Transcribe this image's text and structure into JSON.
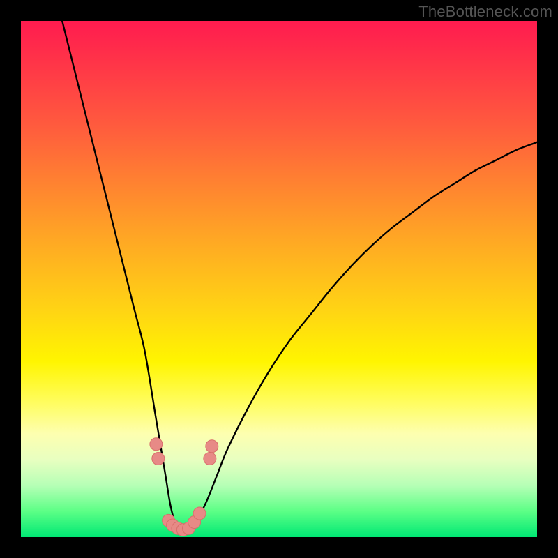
{
  "attribution": "TheBottleneck.com",
  "colors": {
    "frame_background": "#000000",
    "gradient_top": "#ff1b4f",
    "gradient_bottom": "#00e874",
    "curve_stroke": "#000000",
    "marker_fill": "#e78a86",
    "marker_stroke": "#d86f6b",
    "attribution_text": "#555555"
  },
  "chart_data": {
    "type": "line",
    "title": "",
    "xlabel": "",
    "ylabel": "",
    "xlim": [
      0,
      100
    ],
    "ylim": [
      0,
      100
    ],
    "grid": false,
    "note": "Axes are implicit (no visible tick labels in source image). x spans 0–100% of plot width, y spans 0–100% of plot height (0 at bottom). Values read from pixel positions.",
    "series": [
      {
        "name": "bottleneck-curve",
        "x": [
          8,
          10,
          12,
          14,
          16,
          18,
          20,
          22,
          24,
          26,
          27,
          28,
          29,
          30,
          31,
          32,
          33,
          34,
          36,
          38,
          40,
          44,
          48,
          52,
          56,
          60,
          64,
          68,
          72,
          76,
          80,
          84,
          88,
          92,
          96,
          100
        ],
        "y": [
          100,
          92,
          84,
          76,
          68,
          60,
          52,
          44,
          36,
          24,
          18,
          12,
          6,
          2.5,
          1.5,
          1.2,
          1.5,
          3,
          7,
          12,
          17,
          25,
          32,
          38,
          43,
          48,
          52.5,
          56.5,
          60,
          63,
          66,
          68.5,
          71,
          73,
          75,
          76.5
        ]
      }
    ],
    "markers": [
      {
        "x": 26.2,
        "y": 18.0
      },
      {
        "x": 26.6,
        "y": 15.2
      },
      {
        "x": 28.6,
        "y": 3.2
      },
      {
        "x": 29.4,
        "y": 2.3
      },
      {
        "x": 30.4,
        "y": 1.7
      },
      {
        "x": 31.4,
        "y": 1.4
      },
      {
        "x": 32.5,
        "y": 1.7
      },
      {
        "x": 33.6,
        "y": 2.9
      },
      {
        "x": 34.6,
        "y": 4.6
      },
      {
        "x": 36.6,
        "y": 15.2
      },
      {
        "x": 37.0,
        "y": 17.6
      }
    ]
  }
}
